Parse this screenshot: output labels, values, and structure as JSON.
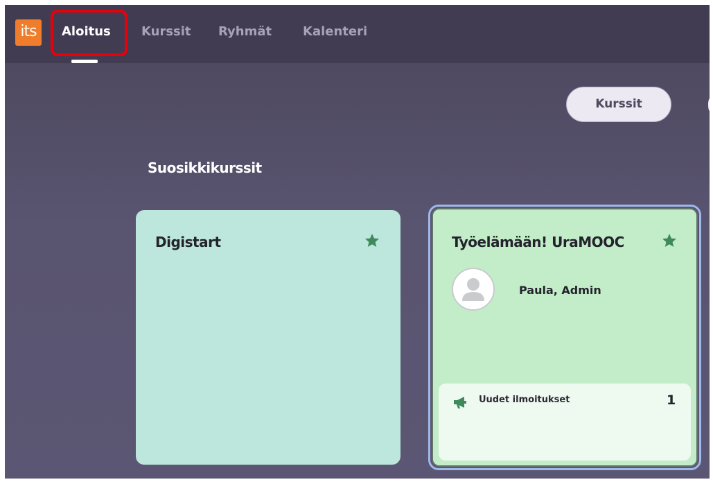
{
  "app": {
    "logo_text": "its",
    "logo_color": "#ef7d2b"
  },
  "nav": {
    "items": [
      {
        "label": "Aloitus",
        "active": true
      },
      {
        "label": "Kurssit",
        "active": false
      },
      {
        "label": "Ryhmät",
        "active": false
      },
      {
        "label": "Kalenteri",
        "active": false
      }
    ],
    "highlight_color": "#e8000b"
  },
  "toolbar": {
    "courses_button_label": "Kurssit"
  },
  "favorites": {
    "title": "Suosikkikurssit",
    "courses": [
      {
        "title": "Digistart",
        "favorite_icon": "star-icon",
        "color": "#bde6dc"
      },
      {
        "title": "Työelämään! UraMOOC",
        "favorite_icon": "star-icon",
        "color": "#c3edc9",
        "teacher": {
          "name": "Paula, Admin",
          "avatar_icon": "user-avatar-icon"
        },
        "notifications": {
          "label": "Uudet ilmoitukset",
          "count": "1",
          "icon": "megaphone-icon"
        }
      }
    ]
  }
}
